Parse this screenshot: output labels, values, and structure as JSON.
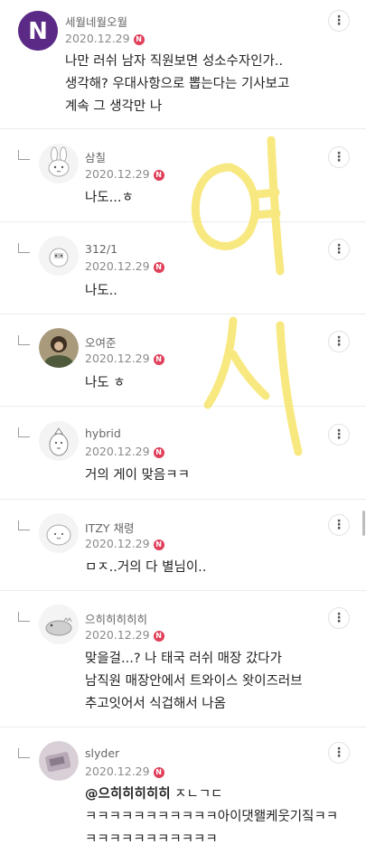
{
  "comments": [
    {
      "nickname": "세월네월오월",
      "date": "2020.12.29",
      "badge": "N",
      "lines": [
        "나만 러쉬 남자 직원보면 성소수자인가..",
        "생각해? 우대사항으로 뽑는다는 기사보고",
        "계속 그 생각만 나"
      ],
      "avatar": "n-logo-avatar"
    },
    {
      "nickname": "삼칠",
      "date": "2020.12.29",
      "badge": "N",
      "lines": [
        "나도...ㅎ"
      ],
      "avatar": "bunny-avatar"
    },
    {
      "nickname": "312/1",
      "date": "2020.12.29",
      "badge": "N",
      "lines": [
        "나도.."
      ],
      "avatar": "chick-avatar"
    },
    {
      "nickname": "오여준",
      "date": "2020.12.29",
      "badge": "N",
      "lines": [
        "나도 ㅎ"
      ],
      "avatar": "photo-avatar"
    },
    {
      "nickname": "hybrid",
      "date": "2020.12.29",
      "badge": "N",
      "lines": [
        "거의 게이 맞음ㅋㅋ"
      ],
      "avatar": "penguin-avatar"
    },
    {
      "nickname": "ITZY 채령",
      "date": "2020.12.29",
      "badge": "N",
      "lines": [
        "ㅁㅈ..거의 다 별님이.."
      ],
      "avatar": "blob-avatar"
    },
    {
      "nickname": "으히히히히히",
      "date": "2020.12.29",
      "badge": "N",
      "lines": [
        "맞을걸...? 나 태국 러쉬 매장 갔다가",
        "남직원 매장안에서 트와이스 왓이즈러브",
        "추고잇어서 식겁해서 나옴"
      ],
      "avatar": "dino-avatar"
    },
    {
      "nickname": "slyder",
      "date": "2020.12.29",
      "badge": "N",
      "mention": "@으히히히히히",
      "lines": [
        "ㅈㄴㄱㄷ",
        "ㅋㅋㅋㅋㅋㅋㅋㅋㅋㅋㅋ아이댓왤케웃기짘ㅋㅋ",
        "ㅋㅋㅋㅋㅋㅋㅋㅋㅋㅋㅋ"
      ],
      "avatar": "photo-avatar-2"
    }
  ],
  "more_label": "⋮",
  "watermark": {
    "color": "#f7e46b",
    "text": "여시"
  }
}
